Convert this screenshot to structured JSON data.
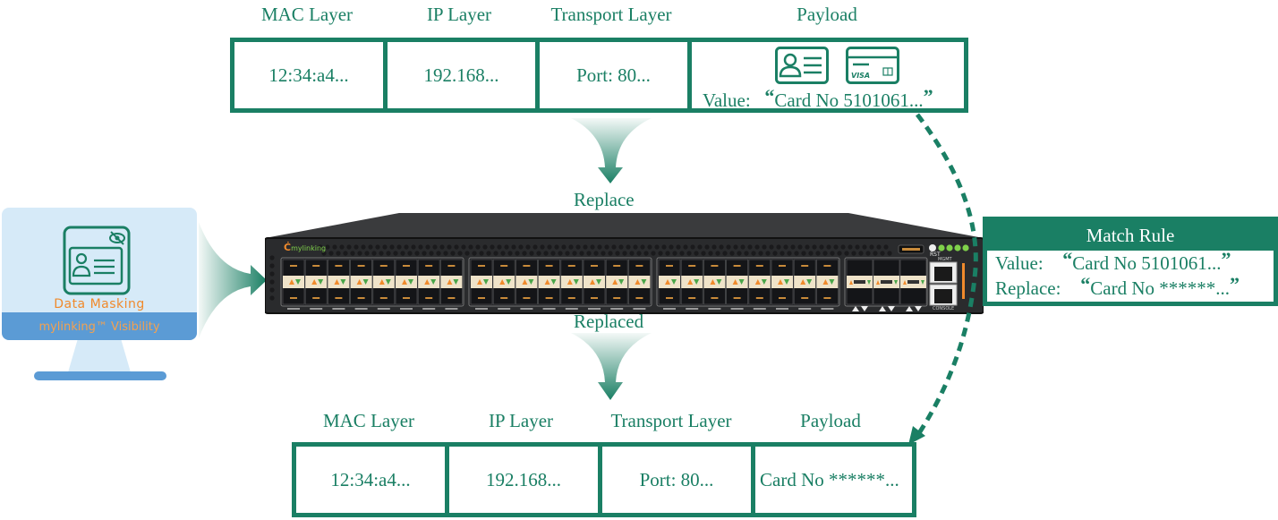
{
  "colors": {
    "primary_green": "#1a7f64",
    "monitor_screen": "#d6eaf8",
    "monitor_bar": "#5b9bd5",
    "accent_orange": "#f08a2c",
    "switch_body": "#2a2b2d",
    "led_green": "#7fd14a"
  },
  "original_packet": {
    "headers": [
      "MAC Layer",
      "IP Layer",
      "Transport Layer",
      "Payload"
    ],
    "cells": [
      "12:34:a4...",
      "192.168...",
      "Port: 80..."
    ],
    "payload": {
      "icons": [
        "id-card-icon",
        "credit-card-icon"
      ],
      "card_brand": "VISA",
      "value_label": "Value:",
      "value": "Card No 5101061...",
      "open_quote": "“",
      "close_quote": "”"
    }
  },
  "flow": {
    "replace_label": "Replace",
    "replaced_label": "Replaced"
  },
  "monitor": {
    "icon": "masked-id-card-icon",
    "title": "Data Masking",
    "subtitle": "mylinking™ Visibility"
  },
  "switch": {
    "brand": "mylinking",
    "reset_label": "RST",
    "mgmt_label": "MGMT",
    "console_label": "CONSOLE",
    "sfp_groups": 3,
    "ports_per_group": 8,
    "qsfp_ports": 3,
    "status_leds": 4
  },
  "match_rule": {
    "title": "Match Rule",
    "value_label": "Value:",
    "value": "Card No 5101061...",
    "replace_label": "Replace:",
    "replace": "Card No ******...",
    "open_quote": "“",
    "close_quote": "”"
  },
  "masked_packet": {
    "headers": [
      "MAC Layer",
      "IP Layer",
      "Transport Layer",
      "Payload"
    ],
    "cells": [
      "12:34:a4...",
      "192.168...",
      "Port: 80...",
      "Card No ******..."
    ]
  }
}
